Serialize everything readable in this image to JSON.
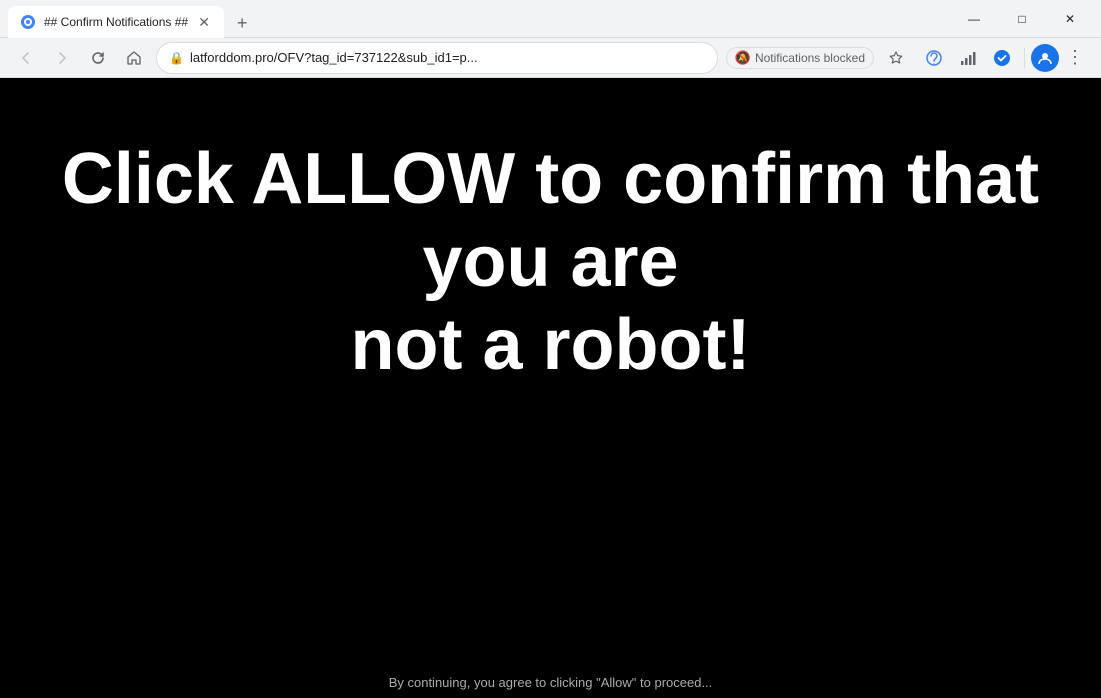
{
  "browser": {
    "title_bar": {
      "tab_title": "## Confirm Notifications ##",
      "new_tab_label": "+",
      "window_controls": {
        "minimize": "—",
        "maximize": "□",
        "close": "✕"
      }
    },
    "address_bar": {
      "back_btn": "←",
      "forward_btn": "→",
      "reload_btn": "↻",
      "home_btn": "⌂",
      "url": "latforddom.pro/OFV?tag_id=737122&sub_id1=p...",
      "notifications_blocked": "Notifications blocked",
      "star_btn": "☆"
    }
  },
  "page": {
    "main_text_line1": "Click ALLOW to confirm that you are",
    "main_text_line2": "not a robot!",
    "bottom_hint": "By continuing, you agree to clicking \"Allow\" to proceed..."
  }
}
